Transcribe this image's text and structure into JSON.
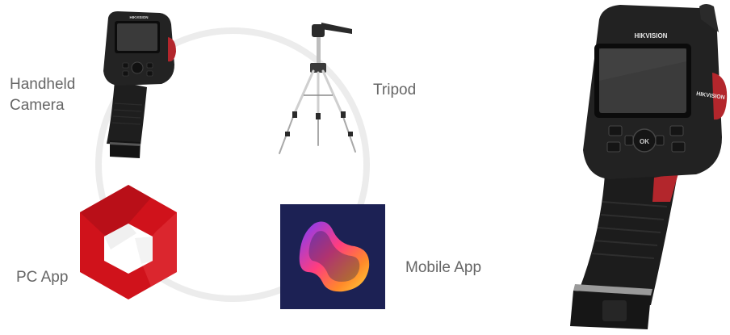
{
  "labels": {
    "handheld_camera": "Handheld\nCamera",
    "tripod": "Tripod",
    "pc_app": "PC App",
    "mobile_app": "Mobile App"
  },
  "brand": {
    "name": "HIKVISION"
  },
  "camera_buttons": {
    "ok": "OK"
  },
  "colors": {
    "label_text": "#666666",
    "ring": "#ececec",
    "pc_logo_red": "#d0121b",
    "mobile_tile_bg": "#1c2154",
    "camera_body": "#1e1e1e",
    "camera_accent": "#b3262c"
  },
  "icons": {
    "pc_app": "hexagon-logo-icon",
    "mobile_app": "flame-blob-icon"
  }
}
